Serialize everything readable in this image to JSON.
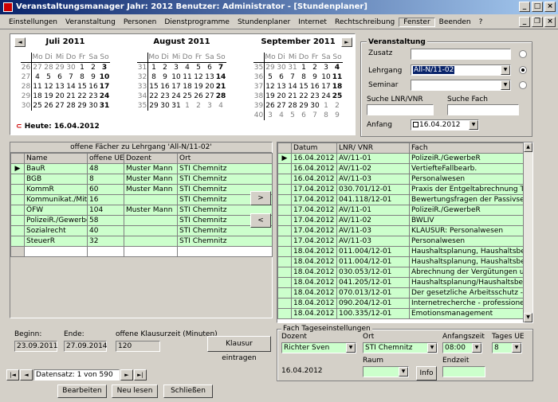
{
  "window": {
    "title": "Veranstaltungsmanager  Jahr: 2012    Benutzer: Administrator - [Stundenplaner]"
  },
  "menu": [
    "Einstellungen",
    "Veranstaltung",
    "Personen",
    "Dienstprogramme",
    "Stundenplaner",
    "Internet",
    "Rechtschreibung",
    "Fenster",
    "Beenden",
    "?"
  ],
  "calendar": {
    "weekday_headers": [
      "Mo",
      "Di",
      "Mi",
      "Do",
      "Fr",
      "Sa",
      "So"
    ],
    "today_label": "Heute: 16.04.2012",
    "months": [
      {
        "name": "Juli 2011",
        "weeks": [
          {
            "wk": "26",
            "days": [
              "27",
              "28",
              "29",
              "30",
              "1",
              "2",
              "3"
            ]
          },
          {
            "wk": "27",
            "days": [
              "4",
              "5",
              "6",
              "7",
              "8",
              "9",
              "10"
            ]
          },
          {
            "wk": "28",
            "days": [
              "11",
              "12",
              "13",
              "14",
              "15",
              "16",
              "17"
            ]
          },
          {
            "wk": "29",
            "days": [
              "18",
              "19",
              "20",
              "21",
              "22",
              "23",
              "24"
            ]
          },
          {
            "wk": "30",
            "days": [
              "25",
              "26",
              "27",
              "28",
              "29",
              "30",
              "31"
            ]
          }
        ]
      },
      {
        "name": "August 2011",
        "weeks": [
          {
            "wk": "31",
            "days": [
              "1",
              "2",
              "3",
              "4",
              "5",
              "6",
              "7"
            ]
          },
          {
            "wk": "32",
            "days": [
              "8",
              "9",
              "10",
              "11",
              "12",
              "13",
              "14"
            ]
          },
          {
            "wk": "33",
            "days": [
              "15",
              "16",
              "17",
              "18",
              "19",
              "20",
              "21"
            ]
          },
          {
            "wk": "34",
            "days": [
              "22",
              "23",
              "24",
              "25",
              "26",
              "27",
              "28"
            ]
          },
          {
            "wk": "35",
            "days": [
              "29",
              "30",
              "31",
              "1",
              "2",
              "3",
              "4"
            ]
          }
        ]
      },
      {
        "name": "September 2011",
        "weeks": [
          {
            "wk": "35",
            "days": [
              "29",
              "30",
              "31",
              "1",
              "2",
              "3",
              "4"
            ]
          },
          {
            "wk": "36",
            "days": [
              "5",
              "6",
              "7",
              "8",
              "9",
              "10",
              "11"
            ]
          },
          {
            "wk": "37",
            "days": [
              "12",
              "13",
              "14",
              "15",
              "16",
              "17",
              "18"
            ]
          },
          {
            "wk": "38",
            "days": [
              "19",
              "20",
              "21",
              "22",
              "23",
              "24",
              "25"
            ]
          },
          {
            "wk": "39",
            "days": [
              "26",
              "27",
              "28",
              "29",
              "30",
              "1",
              "2"
            ]
          },
          {
            "wk": "40",
            "days": [
              "3",
              "4",
              "5",
              "6",
              "7",
              "8",
              "9"
            ]
          }
        ]
      }
    ]
  },
  "veranstaltung": {
    "title": "Veranstaltung",
    "zusatz_label": "Zusatz",
    "zusatz_value": "",
    "lehrgang_label": "Lehrgang",
    "lehrgang_value": "All-N/11-02",
    "seminar_label": "Seminar",
    "seminar_value": "",
    "suche_lnr_label": "Suche LNR/VNR",
    "suche_fach_label": "Suche Fach",
    "anfang_label": "Anfang",
    "anfang_value": "16.04.2012"
  },
  "left_table": {
    "caption": "offene Fächer zu Lehrgang 'All-N/11-02'",
    "headers": [
      "Name",
      "offene UE",
      "Dozent",
      "Ort"
    ],
    "rows": [
      [
        "BauR",
        "48",
        "Muster Mann",
        "STI Chemnitz"
      ],
      [
        "BGB",
        "8",
        "Muster Mann",
        "STI Chemnitz"
      ],
      [
        "KommR",
        "60",
        "Muster Mann",
        "STI Chemnitz"
      ],
      [
        "Kommunikat./Mitar",
        "16",
        "",
        "STI Chemnitz"
      ],
      [
        "ÖFW",
        "104",
        "Muster Mann",
        "STI Chemnitz"
      ],
      [
        "PolizeiR./Gewerbe",
        "58",
        "",
        "STI Chemnitz"
      ],
      [
        "Sozialrecht",
        "40",
        "",
        "STI Chemnitz"
      ],
      [
        "SteuerR",
        "32",
        "",
        "STI Chemnitz"
      ]
    ]
  },
  "right_table": {
    "headers": [
      "Datum",
      "LNR/ VNR",
      "Fach"
    ],
    "rows": [
      [
        "16.04.2012",
        "AV/11-01",
        "PolizeiR./GewerbeR"
      ],
      [
        "16.04.2012",
        "AV/11-02",
        "VertiefteFallbearb."
      ],
      [
        "16.04.2012",
        "AV/11-03",
        "Personalwesen"
      ],
      [
        "17.04.2012",
        "030.701/12-01",
        "Praxis der Entgeltabrechnung Teil I"
      ],
      [
        "17.04.2012",
        "041.118/12-01",
        "Bewertungsfragen der Passivseite"
      ],
      [
        "17.04.2012",
        "AV/11-01",
        "PolizeiR./GewerbeR"
      ],
      [
        "17.04.2012",
        "AV/11-02",
        "BWLIV"
      ],
      [
        "17.04.2012",
        "AV/11-03",
        "KLAUSUR: Personalwesen"
      ],
      [
        "17.04.2012",
        "AV/11-03",
        "Personalwesen"
      ],
      [
        "18.04.2012",
        "011.004/12-01",
        "Haushaltsplanung, Haushaltsbewir"
      ],
      [
        "18.04.2012",
        "011.004/12-01",
        "Haushaltsplanung, Haushaltsbewir"
      ],
      [
        "18.04.2012",
        "030.053/12-01",
        "Abrechnung der Vergütungen und"
      ],
      [
        "18.04.2012",
        "041.205/12-01",
        "Haushaltsplanung/Haushaltsbewir"
      ],
      [
        "18.04.2012",
        "070.013/12-01",
        "Der gesetzliche Arbeitsschutz - Rege"
      ],
      [
        "18.04.2012",
        "090.204/12-01",
        "Internetrecherche - professionell u"
      ],
      [
        "18.04.2012",
        "100.335/12-01",
        "Emotionsmanagement"
      ]
    ]
  },
  "transfer": {
    "right": ">",
    "left": "<"
  },
  "bottom": {
    "beginn_label": "Beginn:",
    "beginn_value": "23.09.2011",
    "ende_label": "Ende:",
    "ende_value": "27.09.2014",
    "klausur_label": "offene Klausurzeit (Minuten)",
    "klausur_value": "120",
    "klausur_button": "Klausur eintragen"
  },
  "fach": {
    "title": "Fach Tageseinstellungen",
    "dozent_label": "Dozent",
    "dozent_value": "Richter Sven",
    "ort_label": "Ort",
    "ort_value": "STI Chemnitz",
    "anfangszeit_label": "Anfangszeit",
    "anfangszeit_value": "08:00",
    "tages_label": "Tages UE",
    "tages_value": "8",
    "date_value": "16.04.2012",
    "raum_label": "Raum",
    "raum_value": "",
    "info_button": "Info",
    "endzeit_label": "Endzeit",
    "endzeit_value": ""
  },
  "nav": {
    "record_text": "Datensatz: 1 von 590",
    "first": "|◄",
    "prev": "◄",
    "next": "►",
    "last": "►|"
  },
  "buttons": {
    "bearbeiten": "Bearbeiten",
    "neu_lesen": "Neu lesen",
    "schliessen": "Schließen"
  }
}
